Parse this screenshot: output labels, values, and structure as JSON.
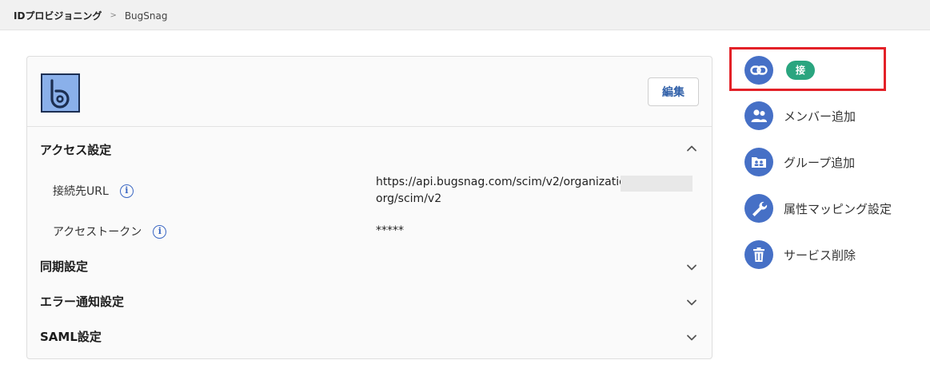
{
  "breadcrumb": {
    "root": "IDプロビジョニング",
    "separator": ">",
    "current": "BugSnag"
  },
  "card": {
    "edit_label": "編集",
    "sections": {
      "access": "アクセス設定",
      "sync": "同期設定",
      "error": "エラー通知設定",
      "saml": "SAML設定"
    },
    "fields": {
      "url_label": "接続先URL",
      "url_value_line1": "https://api.bugsnag.com/scim/v2/organizations",
      "url_value_line2": "org/scim/v2",
      "token_label": "アクセストークン",
      "token_value": "*****"
    },
    "info_glyph": "i"
  },
  "actions": {
    "connected_badge": "接続済",
    "add_member": "メンバー追加",
    "add_group": "グループ追加",
    "attr_mapping": "属性マッピング設定",
    "delete_service": "サービス削除"
  },
  "icons": {
    "logo": "bugsnag-logo",
    "link": "link-icon",
    "members": "people-icon",
    "group": "group-folder-icon",
    "wrench": "wrench-icon",
    "trash": "trash-icon",
    "info": "info-icon",
    "chevron_up": "chevron-up-icon",
    "chevron_down": "chevron-down-icon"
  },
  "colors": {
    "accent": "#4670c6",
    "badge": "#2aa57f",
    "highlight": "#e32128",
    "logo_bg": "#8ab0ea"
  }
}
